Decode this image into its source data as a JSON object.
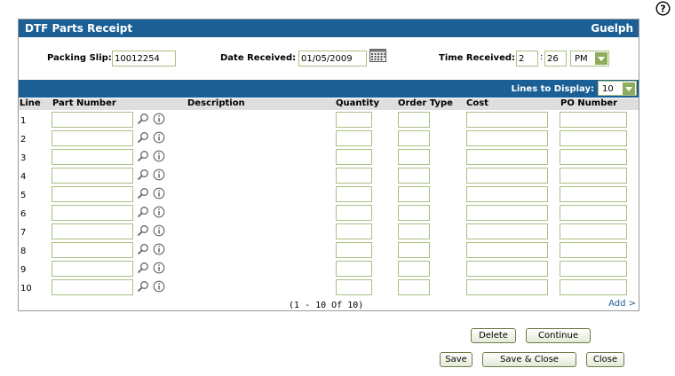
{
  "header": {
    "title": "DTF Parts Receipt",
    "location": "Guelph"
  },
  "form": {
    "packing_slip_label": "Packing Slip:",
    "packing_slip_value": "10012254",
    "date_received_label": "Date Received:",
    "date_received_value": "01/05/2009",
    "time_received_label": "Time Received:",
    "time_hour": "2",
    "time_minute": "26",
    "time_ampm": "PM"
  },
  "lines_bar": {
    "label": "Lines to Display:",
    "value": "10"
  },
  "columns": {
    "line": "Line",
    "part_number": "Part Number",
    "description": "Description",
    "quantity": "Quantity",
    "order_type": "Order Type",
    "cost": "Cost",
    "po_number": "PO Number"
  },
  "rows": [
    "1",
    "2",
    "3",
    "4",
    "5",
    "6",
    "7",
    "8",
    "9",
    "10"
  ],
  "pager": "(1 - 10 Of 10)",
  "add_link": "Add >",
  "buttons": {
    "delete": "Delete",
    "continue": "Continue",
    "save": "Save",
    "save_close": "Save & Close",
    "close": "Close"
  },
  "icons": {
    "help": "help-icon",
    "calendar": "calendar-icon",
    "search": "magnifier-icon",
    "info": "info-icon",
    "dropdown": "chevron-down-icon"
  },
  "colors": {
    "title_bar": "#1b5f95",
    "field_border": "#a8c184",
    "link": "#1f5f99"
  }
}
